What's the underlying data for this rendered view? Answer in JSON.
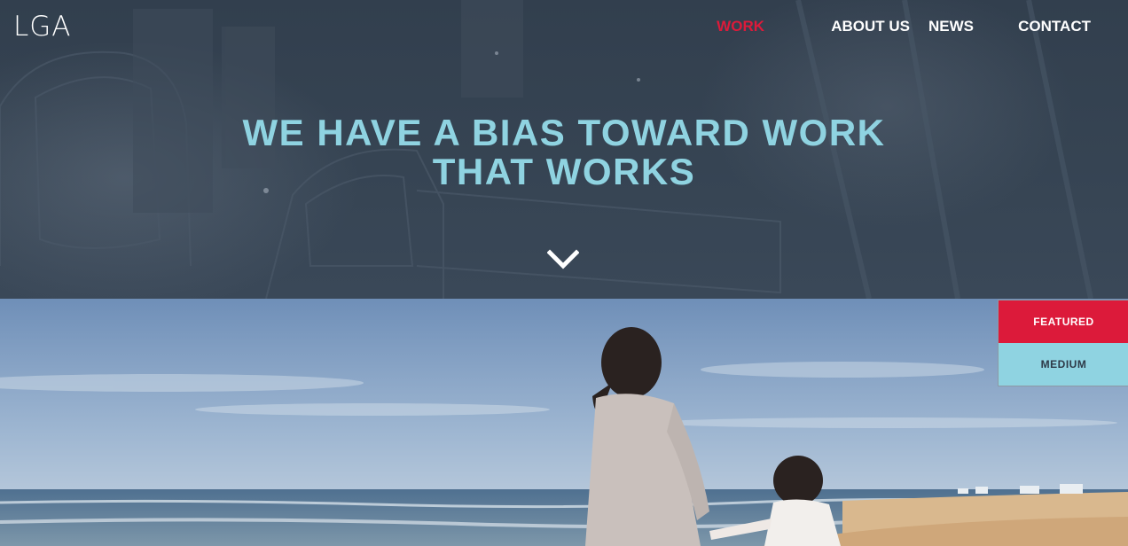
{
  "brand": {
    "logo_text": "LGA"
  },
  "nav": {
    "items": [
      {
        "label": "WORK",
        "active": true
      },
      {
        "label": "ABOUT US",
        "active": false
      },
      {
        "label": "NEWS",
        "active": false
      },
      {
        "label": "CONTACT",
        "active": false
      }
    ]
  },
  "hero": {
    "headline_line1": "WE HAVE A BIAS TOWARD WORK",
    "headline_line2": "THAT WORKS",
    "scroll_icon": "chevron-down-icon"
  },
  "filters": {
    "featured_label": "FEATURED",
    "medium_label": "MEDIUM"
  },
  "colors": {
    "accent_red": "#dc1a3a",
    "accent_cyan": "#8fd3e1",
    "hero_overlay": "#2e3a48"
  }
}
